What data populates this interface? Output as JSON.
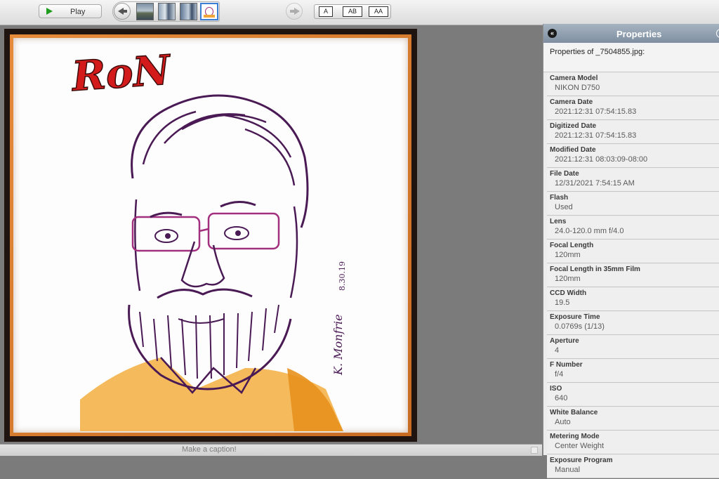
{
  "toolbar": {
    "play_label": "Play",
    "layouts": [
      "A",
      "AB",
      "AA"
    ]
  },
  "caption": {
    "placeholder": "Make a caption!"
  },
  "artwork": {
    "name_text": "RoN",
    "signature_text": "K. Monfrie",
    "date_text": "8.30.19"
  },
  "panel": {
    "title": "Properties",
    "properties_for": "Properties of _7504855.jpg:",
    "properties": [
      {
        "label": "Camera Model",
        "value": "NIKON D750"
      },
      {
        "label": "Camera Date",
        "value": "2021:12:31 07:54:15.83"
      },
      {
        "label": "Digitized Date",
        "value": "2021:12:31 07:54:15.83"
      },
      {
        "label": "Modified Date",
        "value": "2021:12:31 08:03:09-08:00"
      },
      {
        "label": "File Date",
        "value": "12/31/2021 7:54:15 AM"
      },
      {
        "label": "Flash",
        "value": "Used"
      },
      {
        "label": "Lens",
        "value": "24.0-120.0 mm f/4.0"
      },
      {
        "label": "Focal Length",
        "value": "120mm"
      },
      {
        "label": "Focal Length in 35mm Film",
        "value": "120mm"
      },
      {
        "label": "CCD Width",
        "value": "19.5"
      },
      {
        "label": "Exposure Time",
        "value": "0.0769s (1/13)"
      },
      {
        "label": "Aperture",
        "value": "4"
      },
      {
        "label": "F Number",
        "value": "f/4"
      },
      {
        "label": "ISO",
        "value": "640"
      },
      {
        "label": "White Balance",
        "value": "Auto"
      },
      {
        "label": "Metering Mode",
        "value": "Center Weight"
      },
      {
        "label": "Exposure Program",
        "value": "Manual"
      }
    ]
  }
}
